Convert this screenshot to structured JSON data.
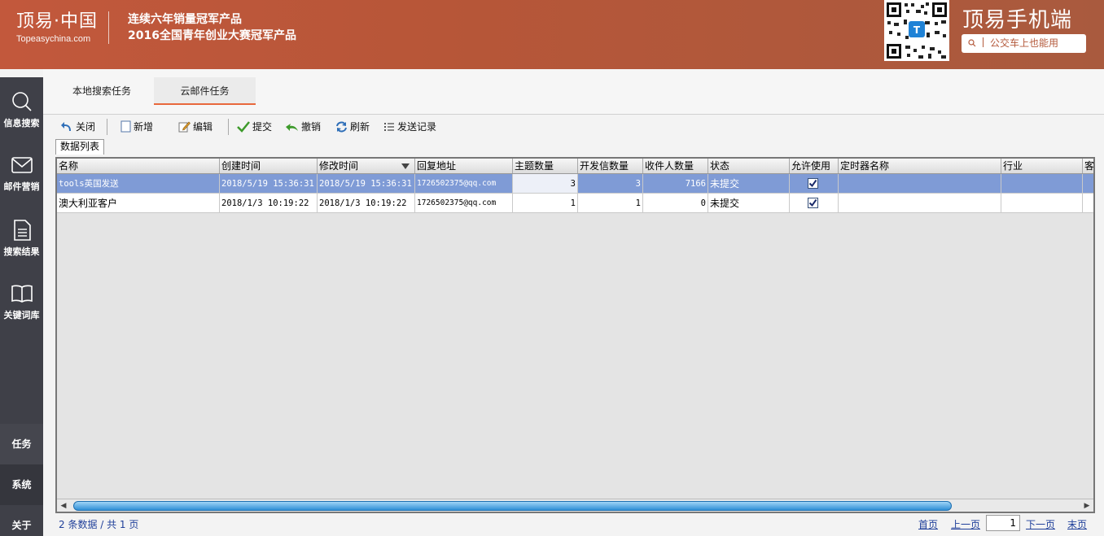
{
  "header": {
    "logo_main": "顶易·中国",
    "logo_sub": "Topeasychina.com",
    "slogan_line1": "连续六年销量冠军产品",
    "slogan_line2": "2016全国青年创业大赛冠军产品",
    "mobile_title": "顶易手机端",
    "mobile_tagline": "公交车上也能用"
  },
  "sidebar": {
    "items": [
      {
        "label": "信息搜索",
        "icon": "search-icon"
      },
      {
        "label": "邮件营销",
        "icon": "mail-icon"
      },
      {
        "label": "搜索结果",
        "icon": "document-icon"
      },
      {
        "label": "关键词库",
        "icon": "book-icon"
      }
    ],
    "bottom": [
      "任务",
      "系统",
      "关于"
    ]
  },
  "tabs": [
    {
      "label": "本地搜索任务",
      "active": false
    },
    {
      "label": "云邮件任务",
      "active": true
    }
  ],
  "toolbar": {
    "close": "关闭",
    "add": "新增",
    "edit": "编辑",
    "submit": "提交",
    "revoke": "撤销",
    "refresh": "刷新",
    "send_log": "发送记录"
  },
  "data_tab": "数据列表",
  "grid": {
    "columns": [
      "名称",
      "创建时间",
      "修改时间",
      "回复地址",
      "主题数量",
      "开发信数量",
      "收件人数量",
      "状态",
      "允许使用",
      "定时器名称",
      "行业",
      "客"
    ],
    "rows": [
      {
        "name": "tools英国发送",
        "created": "2018/5/19 15:36:31",
        "modified": "2018/5/19 15:36:31",
        "reply": "1726502375@qq.com",
        "subjects": "3",
        "letters": "3",
        "recipients": "7166",
        "status": "未提交",
        "allowed": true,
        "timer": "",
        "industry": "",
        "selected": true
      },
      {
        "name": "澳大利亚客户",
        "created": "2018/1/3 10:19:22",
        "modified": "2018/1/3 10:19:22",
        "reply": "1726502375@qq.com",
        "subjects": "1",
        "letters": "1",
        "recipients": "0",
        "status": "未提交",
        "allowed": true,
        "timer": "",
        "industry": "",
        "selected": false
      }
    ]
  },
  "pager": {
    "summary": "2 条数据 / 共 1 页",
    "first": "首页",
    "prev": "上一页",
    "page": "1",
    "next": "下一页",
    "last": "末页"
  },
  "colors": {
    "header_bg": "#b75638",
    "sidebar_bg": "#3f4048",
    "selected_row": "#7f9bd6",
    "tab_accent": "#e8683c",
    "link": "#1f3f9a"
  }
}
